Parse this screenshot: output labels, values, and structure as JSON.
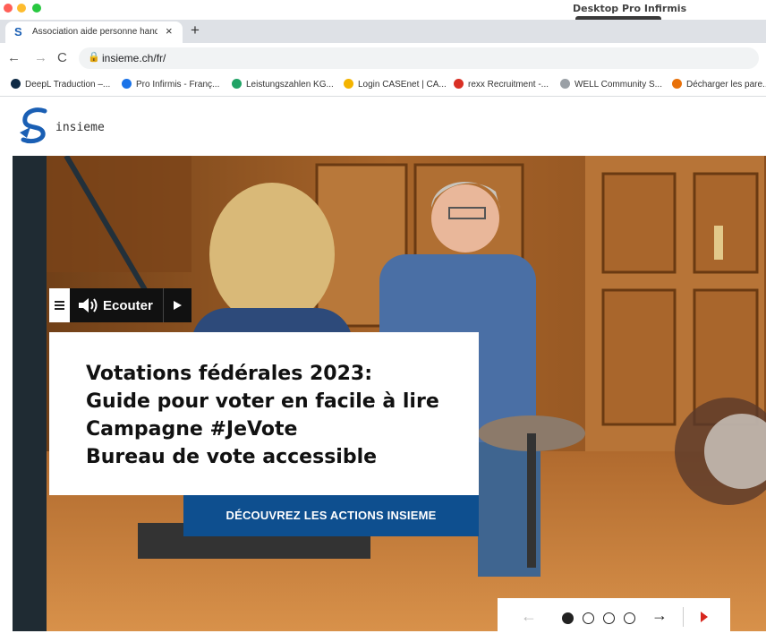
{
  "window": {
    "title": "Desktop Pro Infirmis",
    "keys_hint": "⁞⁞⁞⁞⁞⁞ ◆ ⁞⁞⁞⁞⁞⁞"
  },
  "tab": {
    "title": "Association aide personne handicapée",
    "new_tab": "+"
  },
  "toolbar": {
    "url": "insieme.ch/fr/"
  },
  "bookmarks": [
    {
      "label": "DeepL Traduction –...",
      "color": "#0f2b46"
    },
    {
      "label": "Pro Infirmis - Franç...",
      "color": "#1a73e8"
    },
    {
      "label": "Leistungszahlen KG...",
      "color": "#21a366"
    },
    {
      "label": "Login CASEnet | CA...",
      "color": "#f4b400"
    },
    {
      "label": "rexx Recruitment -...",
      "color": "#d93025"
    },
    {
      "label": "WELL Community S...",
      "color": "#9aa0a6"
    },
    {
      "label": "Décharger les pare...",
      "color": "#e8710a"
    }
  ],
  "site": {
    "logo_text": "insieme"
  },
  "tts": {
    "label": "Ecouter"
  },
  "hero": {
    "lines": [
      "Votations fédérales 2023:",
      "Guide pour voter en facile à lire",
      "Campagne #JeVote",
      "Bureau de vote accessible"
    ],
    "cta_label": "DÉCOUVREZ LES ACTIONS INSIEME"
  },
  "slider": {
    "slides_count": 4,
    "current_slide": 1,
    "prev": "←",
    "next": "→"
  },
  "colors": {
    "brand_blue": "#0e4f8f",
    "accent_red": "#d7261e"
  }
}
